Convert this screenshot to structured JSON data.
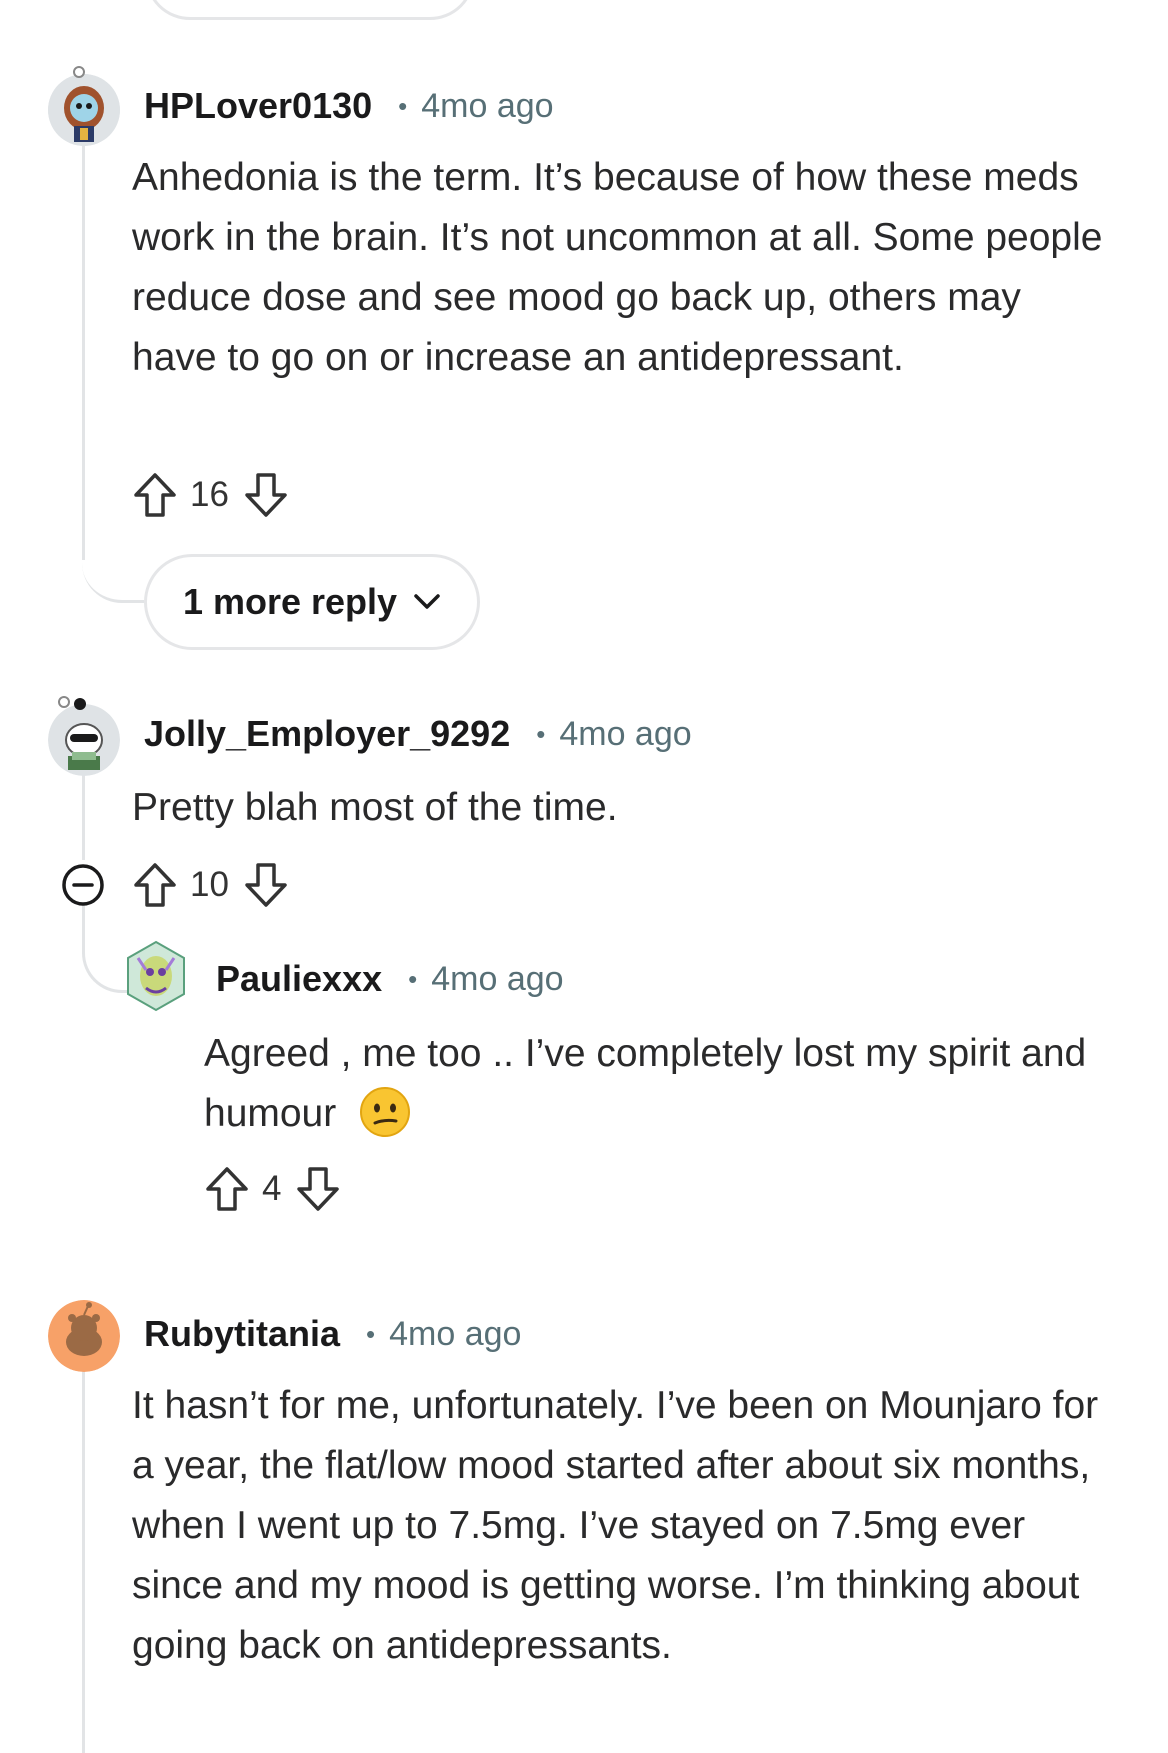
{
  "top_reply_button": {
    "label": ""
  },
  "comments": [
    {
      "username": "HPLover0130",
      "time": "4mo ago",
      "body": "Anhedonia is the term. It’s because of how these meds work in the brain. It’s not uncommon at all. Some people reduce dose and see mood go back up, others may have to go on or increase an antidepressant.",
      "votes": "16",
      "more_replies": "1 more reply"
    },
    {
      "username": "Jolly_Employer_9292",
      "time": "4mo ago",
      "body": "Pretty blah most of the time.",
      "votes": "10"
    },
    {
      "username": "Pauliexxx",
      "time": "4mo ago",
      "body": "Agreed , me too .. I’ve completely lost my spirit and humour",
      "votes": "4"
    },
    {
      "username": "Rubytitania",
      "time": "4mo ago",
      "body": "It hasn’t for me, unfortunately. I’ve been on Mounjaro for a year, the flat/low mood started after about six months, when I went up to 7.5mg. I’ve stayed on 7.5mg ever since and my mood is getting worse. I’m thinking about going back on antidepressants."
    }
  ],
  "colors": {
    "thread_line": "#e2e4e6",
    "meta_text": "#576f76",
    "ruby_avatar_bg": "#f7a168"
  },
  "icons": [
    "upvote-icon",
    "downvote-icon",
    "chevron-down-icon",
    "collapse-icon",
    "confused-face-emoji"
  ]
}
